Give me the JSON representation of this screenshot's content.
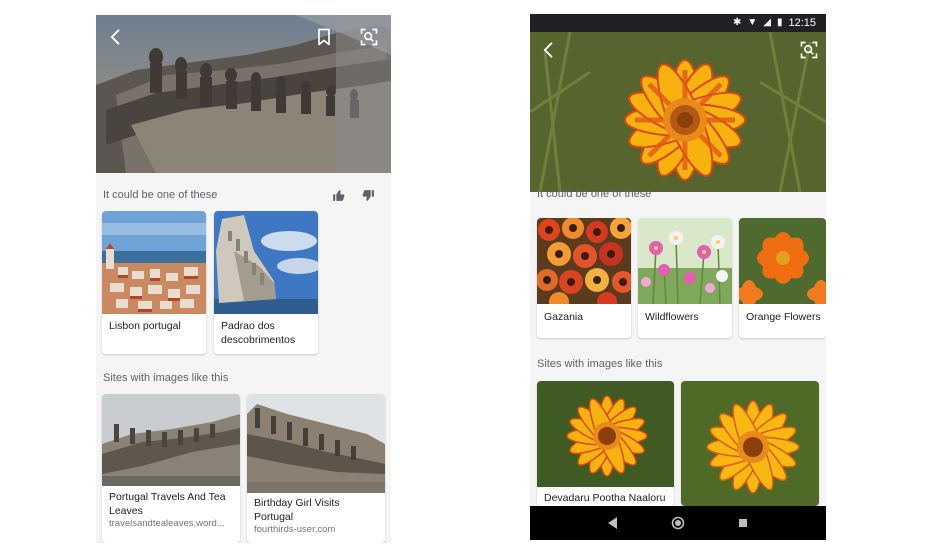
{
  "left_screen": {
    "section_identify": {
      "title": "It could be one of these",
      "cards": [
        {
          "label": "Lisbon portugal"
        },
        {
          "label": "Padrao dos descobrimentos"
        }
      ]
    },
    "section_sites": {
      "title": "Sites with images like this",
      "cards": [
        {
          "title": "Portugal Travels And Tea Leaves",
          "source": "travelsandtealeaves.word..."
        },
        {
          "title": "Birthday Girl Visits Portugal",
          "source": "fourthirds-user.com"
        }
      ]
    }
  },
  "right_screen": {
    "status_bar": {
      "time": "12:15"
    },
    "section_identify": {
      "title": "It could be one of these",
      "cards": [
        {
          "label": "Gazania"
        },
        {
          "label": "Wildflowers"
        },
        {
          "label": "Orange Flowers"
        }
      ]
    },
    "section_sites": {
      "title": "Sites with images like this",
      "cards": [
        {
          "title": "Devadaru Pootha Naaloru"
        },
        {
          "title": ""
        }
      ]
    }
  },
  "icons": {
    "back": "chevron-left-icon",
    "bookmark": "bookmark-icon",
    "visual_search": "lens-icon",
    "like": "thumb-up-icon",
    "dislike": "thumb-down-icon"
  }
}
